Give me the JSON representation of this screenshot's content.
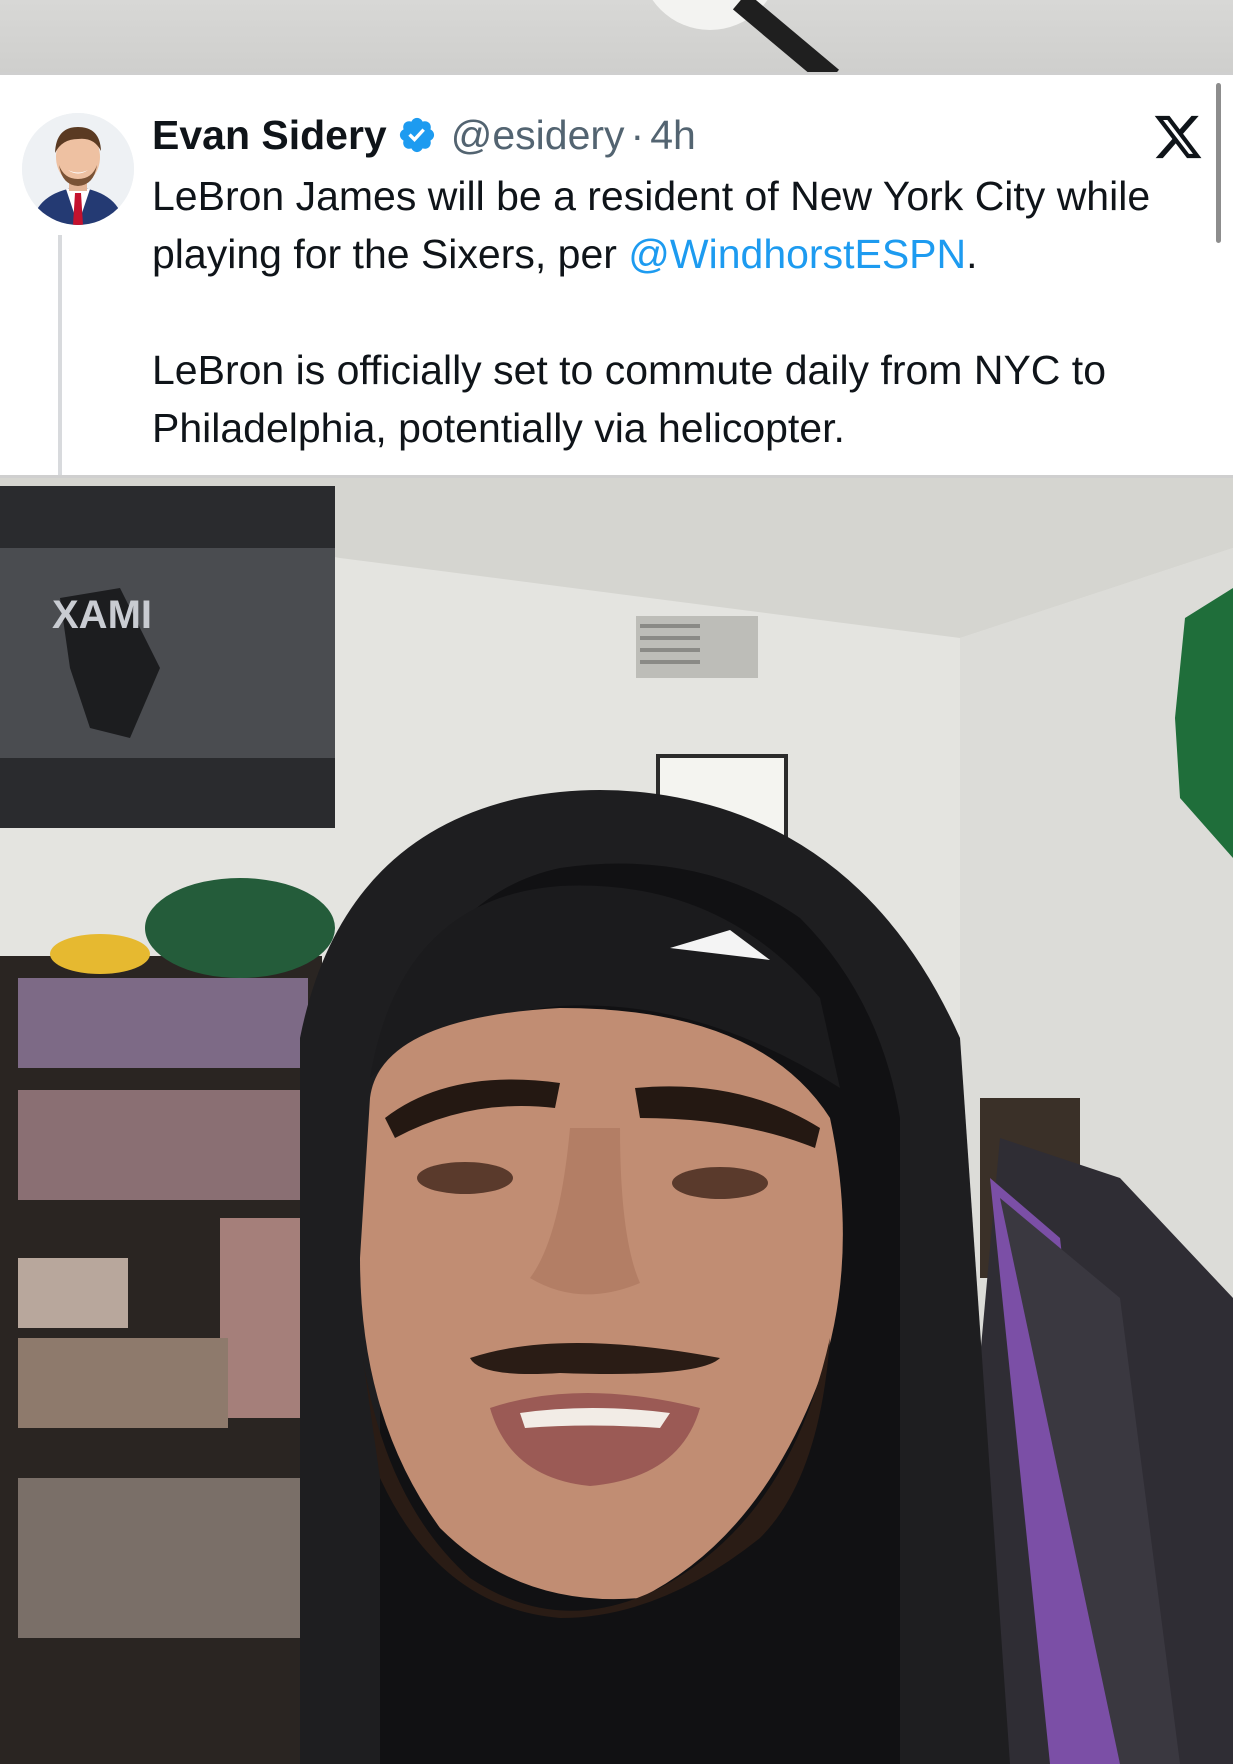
{
  "tweet": {
    "author_name": "Evan Sidery",
    "verified_icon": "verified-badge-icon",
    "handle": "@esidery",
    "separator": "·",
    "time": "4h",
    "platform_icon": "x-logo-icon",
    "text_line1_pre": "LeBron James will be a resident of New York City while playing for the Sixers, per ",
    "mention": "@WindhorstESPN",
    "text_line1_post": ".",
    "text_paragraph2": "LeBron is officially set to commute daily from NYC to Philadelphia, potentially via helicopter."
  },
  "colors": {
    "verified_blue": "#1d9bf0",
    "link_blue": "#1d9bf0",
    "text_primary": "#0f1419",
    "text_secondary": "#536471"
  },
  "video": {
    "poster_text": "XAMI"
  }
}
